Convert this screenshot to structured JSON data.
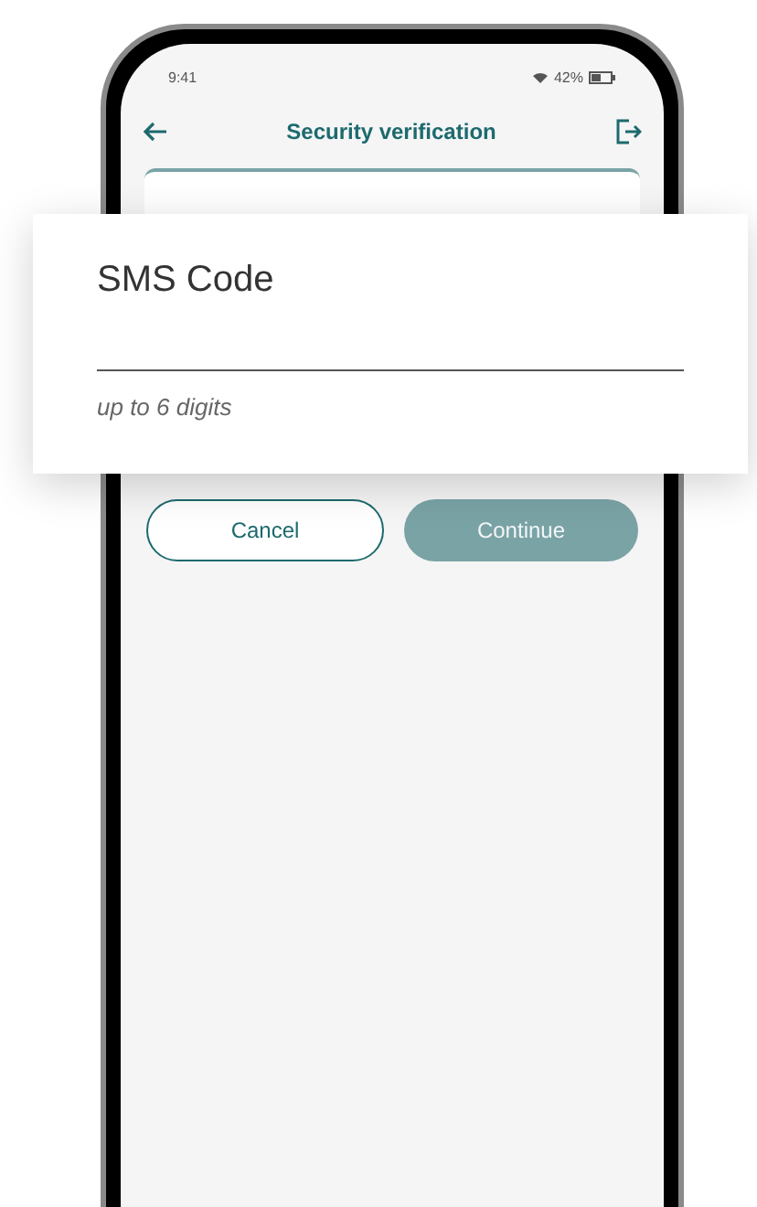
{
  "status_bar": {
    "time": "9:41",
    "battery": "42%"
  },
  "header": {
    "title": "Security verification"
  },
  "sms_field": {
    "label": "SMS Code",
    "hint": "up to 6 digits"
  },
  "buttons": [
    {
      "label": "Cancel",
      "kind": "secondary",
      "disabled": false
    },
    {
      "label": "Continue",
      "kind": "primary",
      "disabled": true
    }
  ]
}
